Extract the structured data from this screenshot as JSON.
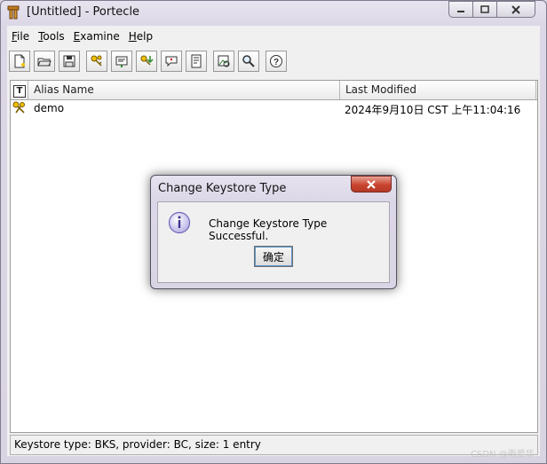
{
  "window": {
    "title": "[Untitled] - Portecle"
  },
  "menu": [
    {
      "key": "F",
      "rest": "ile"
    },
    {
      "key": "T",
      "rest": "ools"
    },
    {
      "key": "E",
      "rest": "xamine"
    },
    {
      "key": "H",
      "rest": "elp"
    }
  ],
  "toolbar_icons": [
    "new-keystore-icon",
    "open-keystore-icon",
    "save-keystore-icon",
    "generate-keypair-icon",
    "import-trusted-cert-icon",
    "import-keypair-icon",
    "set-password-icon",
    "keystore-report-icon",
    "examine-certificate-icon",
    "examine-ssl-icon",
    "help-icon"
  ],
  "table": {
    "type_header": "T",
    "headers": [
      "Alias Name",
      "Last Modified"
    ],
    "rows": [
      {
        "alias": "demo",
        "modified": "2024年9月10日 CST 上午11:04:16"
      }
    ]
  },
  "status": "Keystore type: BKS, provider: BC, size: 1 entry",
  "dialog": {
    "title": "Change Keystore Type",
    "message": "Change Keystore Type Successful.",
    "ok_label": "确定"
  },
  "watermark": "CSDN @雨爱华"
}
